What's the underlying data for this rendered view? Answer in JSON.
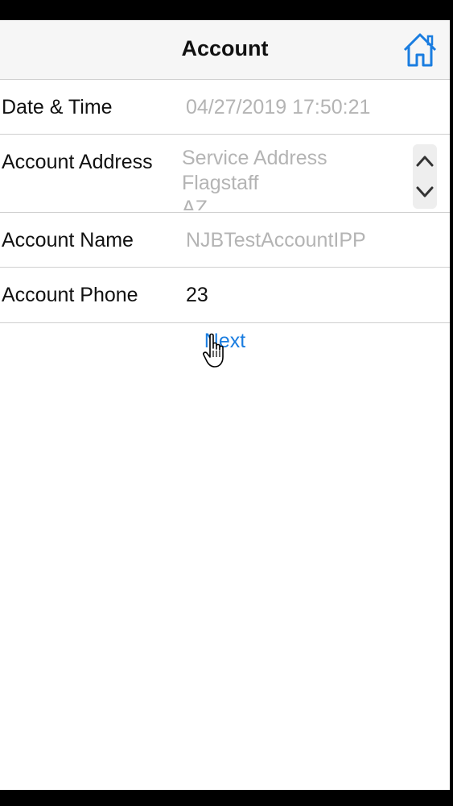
{
  "header": {
    "title": "Account",
    "home_icon": "home-icon"
  },
  "form": {
    "date_time": {
      "label": "Date & Time",
      "value": "04/27/2019 17:50:21"
    },
    "account_address": {
      "label": "Account Address",
      "lines": [
        "Service Address",
        "Flagstaff",
        "AZ"
      ]
    },
    "account_name": {
      "label": "Account Name",
      "value": "NJBTestAccountIPP"
    },
    "account_phone": {
      "label": "Account Phone",
      "value": "23"
    }
  },
  "actions": {
    "next_label": "Next"
  },
  "colors": {
    "accent": "#1a7de0",
    "placeholder_text": "#b4b4b4",
    "divider": "#cfcfcf",
    "header_bg": "#f6f6f6"
  }
}
